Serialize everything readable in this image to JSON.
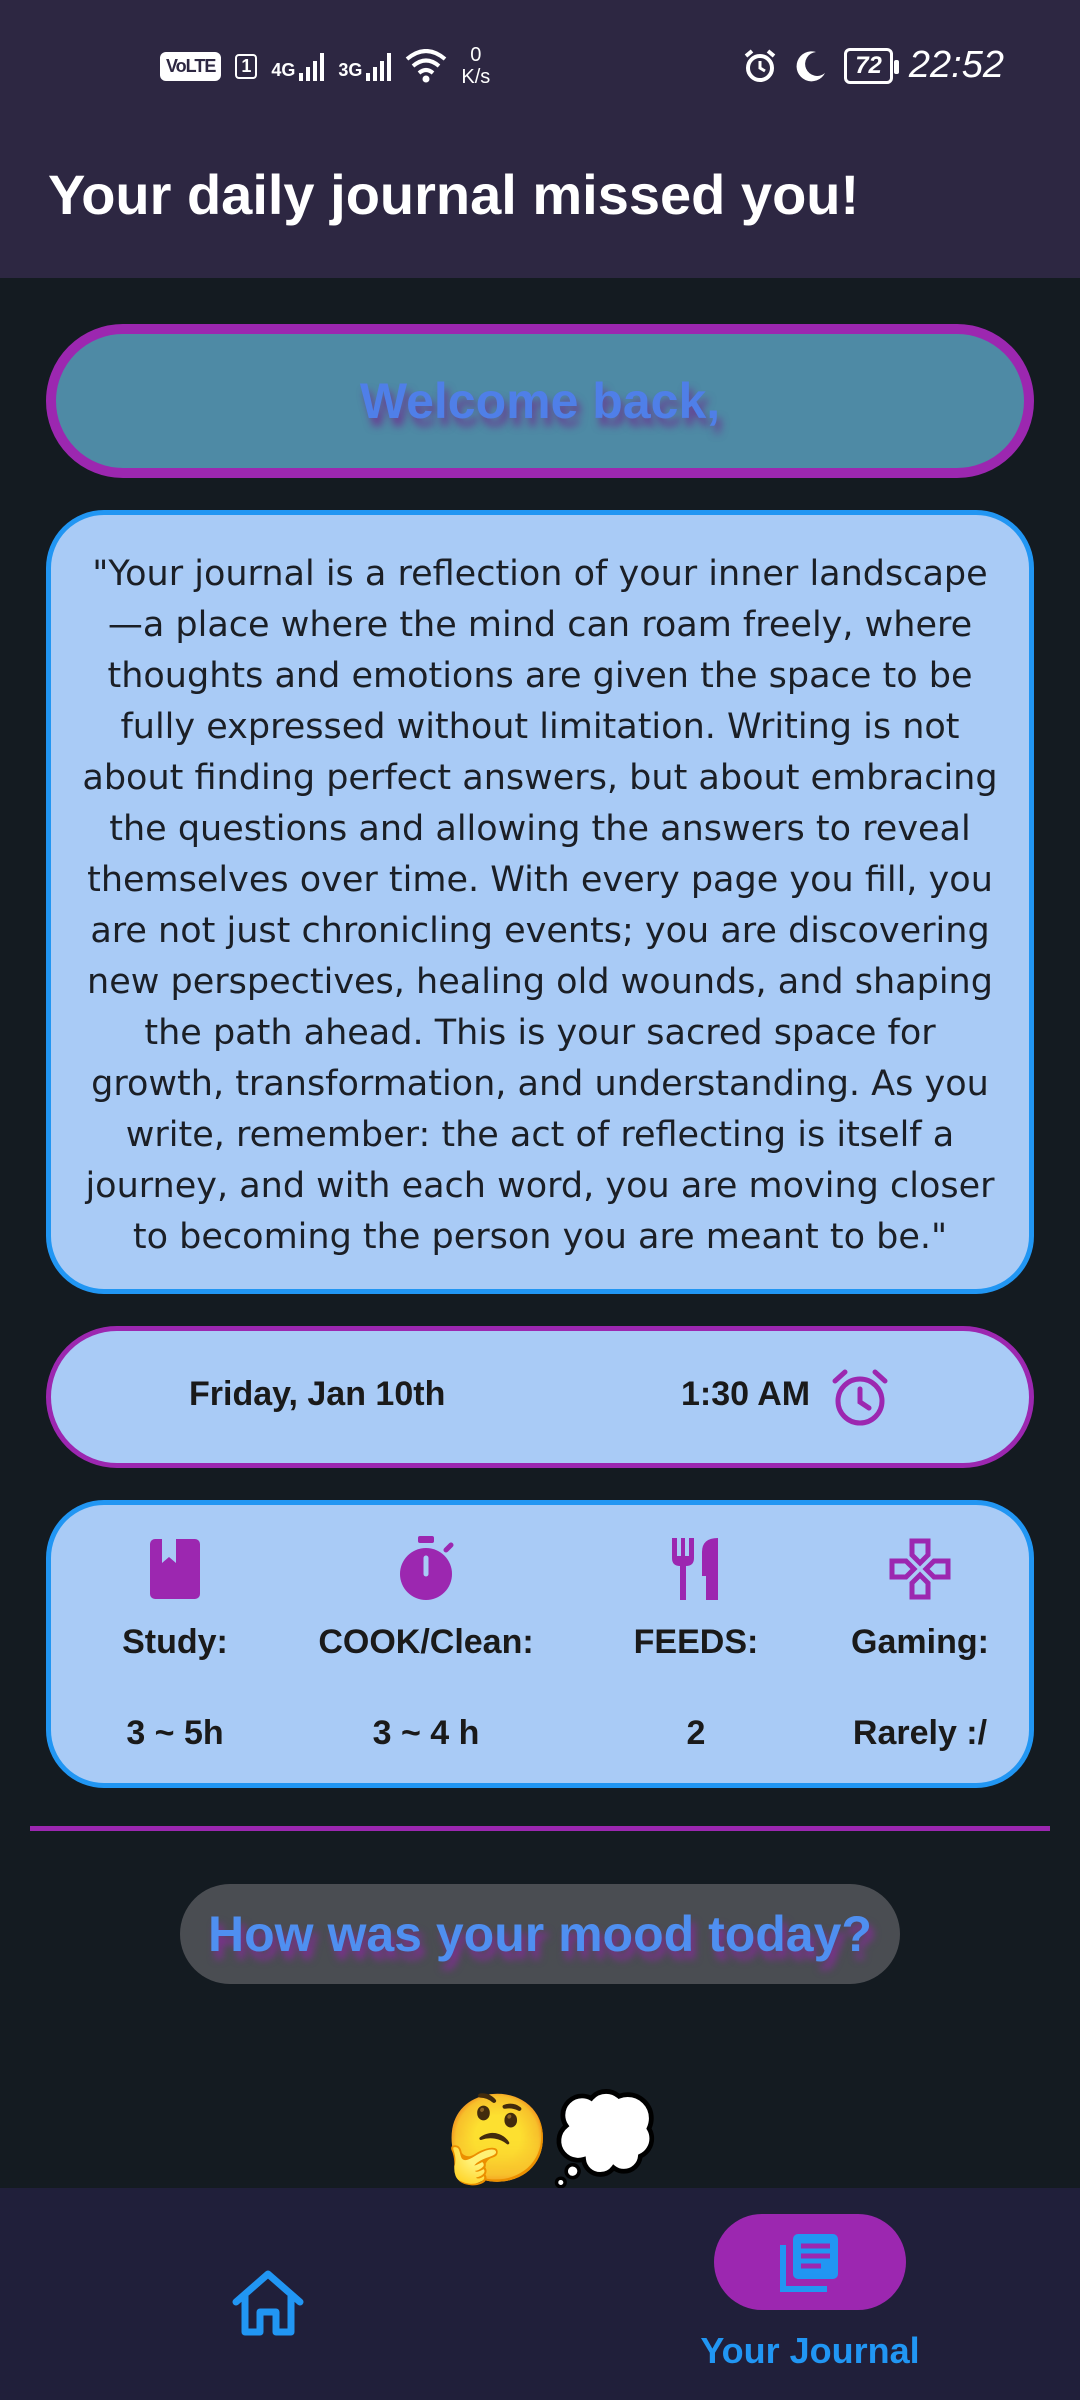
{
  "status_bar": {
    "volte": "VoLTE",
    "sim": "1",
    "net1": "4G",
    "net2": "3G",
    "speed_value": "0",
    "speed_unit": "K/s",
    "battery": "72",
    "time": "22:52"
  },
  "app_bar": {
    "title": "Your daily journal missed you!"
  },
  "welcome": {
    "text": "Welcome back,"
  },
  "quote": {
    "text": "\"Your journal is a reflection of your inner landscape—a place where the mind can roam freely, where thoughts and emotions are given the space to be fully expressed without limitation. Writing is not about finding perfect answers, but about embracing the questions and allowing the answers to reveal themselves over time. With every page you fill, you are not just chronicling events; you are discovering new perspectives, healing old wounds, and shaping the path ahead. This is your sacred space for growth, transformation, and understanding. As you write, remember: the act of reflecting is itself a journey, and with each word, you are moving closer to becoming the person you are meant to be.\""
  },
  "datetime": {
    "date": "Friday, Jan 10th",
    "time": "1:30 AM",
    "icon": "alarm-clock-icon"
  },
  "stats": [
    {
      "icon": "book-icon",
      "label": "Study:",
      "value": "3 ~ 5h"
    },
    {
      "icon": "stopwatch-icon",
      "label": "COOK/Clean:",
      "value": "3 ~ 4 h"
    },
    {
      "icon": "fork-knife-icon",
      "label": "FEEDS:",
      "value": "2"
    },
    {
      "icon": "gamepad-icon",
      "label": "Gaming:",
      "value": "Rarely :/"
    }
  ],
  "mood": {
    "prompt": "How was your mood today?",
    "emoji": "🤔💭"
  },
  "bottom_nav": {
    "home_icon": "home-icon",
    "journal_icon": "journal-icon",
    "journal_label": "Your Journal"
  },
  "colors": {
    "accent_purple": "#9c27b0",
    "accent_blue": "#2196f3",
    "card_bg": "#a9cbf6",
    "header_bg": "#2d2742",
    "page_bg": "#141b21"
  }
}
